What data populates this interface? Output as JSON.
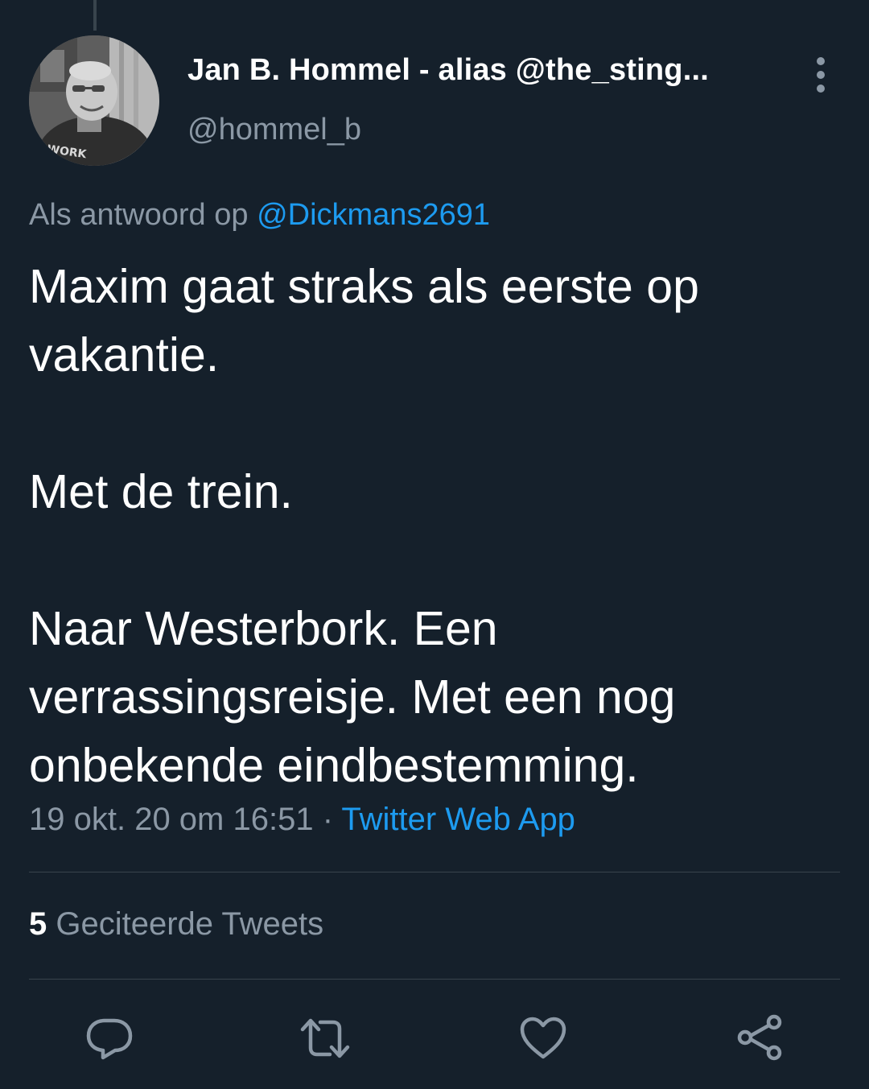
{
  "tweet": {
    "author_name": "Jan B. Hommel - alias @the_sting...",
    "author_handle": "@hommel_b",
    "reply_prefix": "Als antwoord op",
    "reply_to": "@Dickmans2691",
    "text_lines": [
      "Maxim gaat straks als eerste op",
      "vakantie.",
      "Met de trein.",
      "Naar Westerbork. Een",
      "verrassingsreisje. Met een nog",
      "onbekende eindbestemming."
    ],
    "timestamp": "19 okt. 20 om 16:51",
    "separator": "·",
    "source": "Twitter Web App",
    "quote_count": "5",
    "quote_label": "Geciteerde Tweets",
    "avatar_shirt_text": "WORK"
  },
  "icons": {
    "more": "more-vertical-icon",
    "reply": "reply-icon",
    "retweet": "retweet-icon",
    "like": "heart-icon",
    "share": "share-icon"
  },
  "colors": {
    "background": "#15202b",
    "text": "#ffffff",
    "muted": "#8b98a5",
    "link": "#1d9bf0",
    "divider": "#38444d"
  }
}
